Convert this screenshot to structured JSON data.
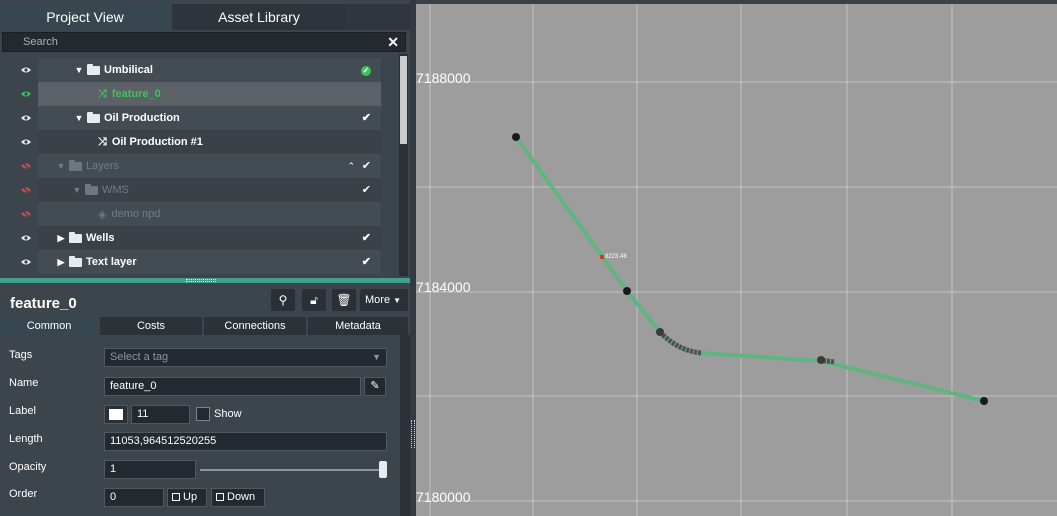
{
  "tabs": [
    "Project View",
    "Asset Library"
  ],
  "search": {
    "placeholder": "Search",
    "clear_icon": "close-icon"
  },
  "tree": [
    {
      "label": "Umbilical",
      "type": "folder-open",
      "visible": true,
      "status": "ok-badge"
    },
    {
      "label": "feature_0",
      "type": "feature",
      "visible": true,
      "selected": true
    },
    {
      "label": "Oil Production",
      "type": "folder-open",
      "visible": true,
      "status": "check"
    },
    {
      "label": "Oil Production #1",
      "type": "feature",
      "visible": true
    },
    {
      "label": "Layers",
      "type": "folder-open",
      "visible": false,
      "status": "check",
      "disabled": true
    },
    {
      "label": "WMS",
      "type": "folder-open",
      "visible": false,
      "status": "check",
      "disabled": true
    },
    {
      "label": "demo npd",
      "type": "layers",
      "visible": false,
      "disabled": true
    },
    {
      "label": "Wells",
      "type": "folder-closed",
      "visible": true,
      "status": "check"
    },
    {
      "label": "Text layer",
      "type": "folder-closed",
      "visible": true,
      "status": "check"
    }
  ],
  "feature": {
    "title": "feature_0",
    "toolbar": {
      "more_label": "More"
    },
    "tabs": [
      "Common",
      "Costs",
      "Connections",
      "Metadata"
    ],
    "fields": {
      "tags_label": "Tags",
      "tags_placeholder": "Select a tag",
      "name_label": "Name",
      "name_value": "feature_0",
      "label_label": "Label",
      "label_size": "11",
      "show_label": "Show",
      "length_label": "Length",
      "length_value": "11053,964512520255",
      "opacity_label": "Opacity",
      "opacity_value": "1",
      "order_label": "Order",
      "order_value": "0",
      "up_label": "Up",
      "down_label": "Down"
    }
  },
  "map": {
    "y_labels": [
      "7188000",
      "7184000",
      "7180000"
    ],
    "segment_label": "8223.48",
    "line_color": "#5fb57f",
    "background": "#9d9d9d"
  },
  "colors": {
    "accent": "#3ea389",
    "selected_green": "#3ec25a",
    "hidden_eye": "#c05050"
  }
}
